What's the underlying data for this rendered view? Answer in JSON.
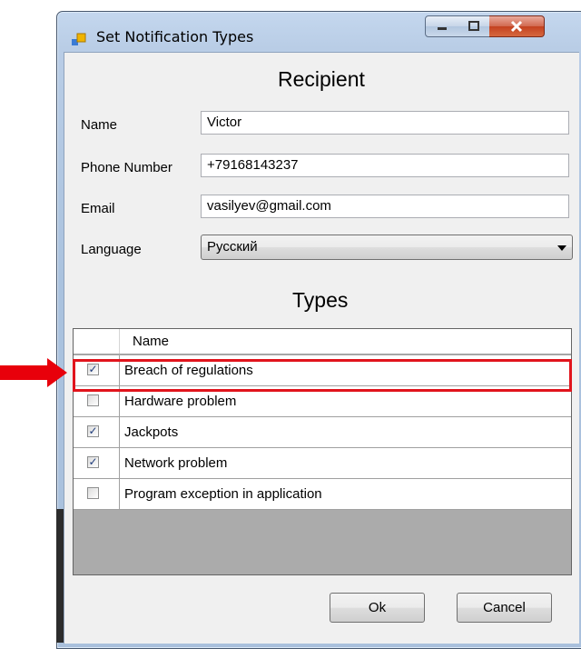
{
  "window": {
    "title": "Set Notification Types"
  },
  "recipient": {
    "heading": "Recipient",
    "name_label": "Name",
    "name_value": "Victor",
    "phone_label": "Phone Number",
    "phone_value": "+79168143237",
    "email_label": "Email",
    "email_value": "vasilyev@gmail.com",
    "language_label": "Language",
    "language_value": "Русский"
  },
  "types": {
    "heading": "Types",
    "column_name": "Name",
    "rows": [
      {
        "label": "Breach of regulations",
        "checked": true
      },
      {
        "label": "Hardware problem",
        "checked": false
      },
      {
        "label": "Jackpots",
        "checked": true
      },
      {
        "label": "Network problem",
        "checked": true
      },
      {
        "label": "Program exception in application",
        "checked": false
      }
    ]
  },
  "buttons": {
    "ok": "Ok",
    "cancel": "Cancel"
  },
  "colors": {
    "highlight": "#e1141c",
    "arrow": "#e8000b"
  }
}
